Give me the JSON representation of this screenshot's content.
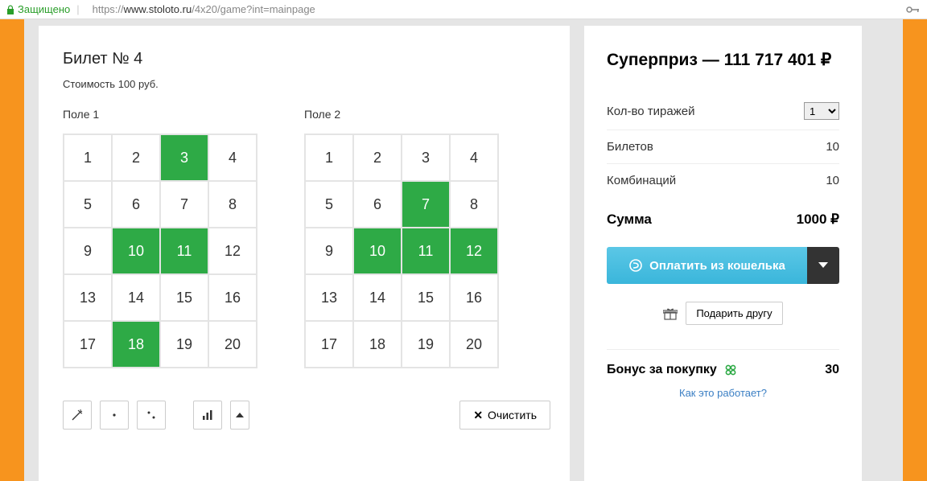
{
  "url": {
    "secure_label": "Защищено",
    "prefix": "https://",
    "domain": "www.stoloto.ru",
    "path": "/4x20/game?int=mainpage"
  },
  "ticket": {
    "title": "Билет № 4",
    "cost": "Стоимость 100 руб.",
    "field1_label": "Поле 1",
    "field2_label": "Поле 2",
    "field1_selected": [
      3,
      10,
      11,
      18
    ],
    "field2_selected": [
      7,
      10,
      11,
      12
    ],
    "clear_label": "Очистить"
  },
  "sidebar": {
    "super_label": "Суперприз —  111 717 401 ₽",
    "draws_label": "Кол-во тиражей",
    "draws_value": "1",
    "tickets_label": "Билетов",
    "tickets_value": "10",
    "combos_label": "Комбинаций",
    "combos_value": "10",
    "sum_label": "Сумма",
    "sum_value": "1000 ₽",
    "pay_label": "Оплатить из кошелька",
    "gift_label": "Подарить другу",
    "bonus_label": "Бонус за покупку",
    "bonus_value": "30",
    "how_label": "Как это работает?"
  }
}
